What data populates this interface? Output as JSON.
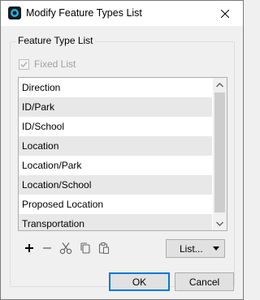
{
  "window": {
    "title": "Modify Feature Types List"
  },
  "group": {
    "title": "Feature Type List",
    "fixed_list": {
      "label": "Fixed List",
      "checked": true,
      "enabled": false
    }
  },
  "feature_types": [
    "Direction",
    "ID/Park",
    "ID/School",
    "Location",
    "Location/Park",
    "Location/School",
    "Proposed Location",
    "Transportation"
  ],
  "toolbar": {
    "icons": [
      "add-icon",
      "remove-icon",
      "cut-icon",
      "copy-icon",
      "paste-icon"
    ],
    "list_button_label": "List..."
  },
  "buttons": {
    "ok": "OK",
    "cancel": "Cancel"
  }
}
